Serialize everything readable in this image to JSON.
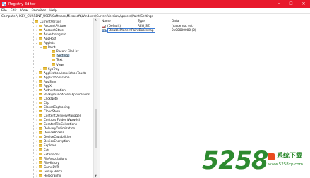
{
  "titlebar": {
    "title": "Registry Editor",
    "minimize": "─",
    "maximize": "☐",
    "close": "✕"
  },
  "menu": [
    "File",
    "Edit",
    "View",
    "Favorites",
    "Help"
  ],
  "address": "Computer\\HKEY_CURRENT_USER\\Software\\Microsoft\\Windows\\CurrentVersion\\Applets\\Paint\\Settings",
  "tree": [
    {
      "label": "CurrentVersion",
      "expander": "⌄"
    },
    {
      "label": "AccountPicture",
      "expander": "›"
    },
    {
      "label": "AccountState",
      "expander": "›"
    },
    {
      "label": "Advertisinginfo",
      "expander": "›"
    },
    {
      "label": "AppHost",
      "expander": "›"
    },
    {
      "label": "Applets",
      "expander": "⌄"
    },
    {
      "label": "Paint",
      "expander": "⌄"
    },
    {
      "label": "Recent File List",
      "expander": ""
    },
    {
      "label": "Settings",
      "expander": "",
      "selected": true
    },
    {
      "label": "Text",
      "expander": ""
    },
    {
      "label": "View",
      "expander": ""
    },
    {
      "label": "SysTray",
      "expander": "›"
    },
    {
      "label": "ApplicationAssociationToasts",
      "expander": "›"
    },
    {
      "label": "ApplicationFrame",
      "expander": "›"
    },
    {
      "label": "AppSync",
      "expander": "›"
    },
    {
      "label": "AppX",
      "expander": "›"
    },
    {
      "label": "Authentication",
      "expander": "›"
    },
    {
      "label": "BackgroundAccessApplications",
      "expander": "›"
    },
    {
      "label": "ClickNote",
      "expander": "›"
    },
    {
      "label": "Clip",
      "expander": "›"
    },
    {
      "label": "ClosedCaptioning",
      "expander": "›"
    },
    {
      "label": "CloudStore",
      "expander": "›"
    },
    {
      "label": "ContentDeliveryManager",
      "expander": "›"
    },
    {
      "label": "Controls Folder (Wow64)",
      "expander": "›"
    },
    {
      "label": "CuratedTileCollections",
      "expander": "›"
    },
    {
      "label": "DeliveryOptimization",
      "expander": "›"
    },
    {
      "label": "DeviceAccess",
      "expander": "›"
    },
    {
      "label": "DeviceCapabilities",
      "expander": "›"
    },
    {
      "label": "DeviceEncryption",
      "expander": "›"
    },
    {
      "label": "Explorer",
      "expander": "›"
    },
    {
      "label": "Ext",
      "expander": "›"
    },
    {
      "label": "Extensions",
      "expander": "›"
    },
    {
      "label": "FileAssociations",
      "expander": "›"
    },
    {
      "label": "FileHistory",
      "expander": "›"
    },
    {
      "label": "GameDVR",
      "expander": "›"
    },
    {
      "label": "Group Policy",
      "expander": "›"
    },
    {
      "label": "Holographic",
      "expander": "›"
    }
  ],
  "columns": {
    "name": "Name",
    "type": "Type",
    "data": "Data"
  },
  "values": [
    {
      "icon": "ab",
      "name": "(Default)",
      "type": "REG_SZ",
      "data": "(value not set)",
      "editing": false
    },
    {
      "icon": "010",
      "name": "DisableModernPaintBootstrap",
      "type": "",
      "data": "0x00000000 (0)",
      "editing": true
    }
  ],
  "watermark": {
    "number": "5258",
    "text": "系统下载",
    "url": "www.5258xp.com"
  }
}
